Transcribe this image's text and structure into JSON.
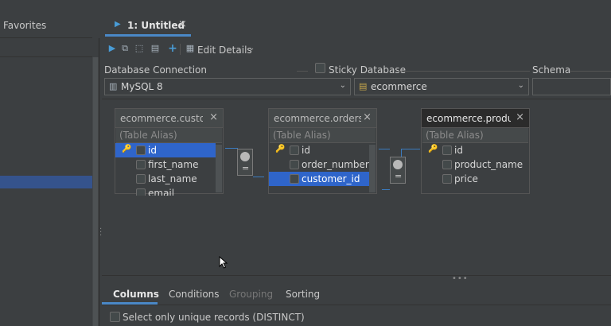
{
  "left_panel": {
    "title": "Favorites"
  },
  "tab": {
    "label": "1: Untitled",
    "close": "×"
  },
  "toolbar": {
    "edit_details": "Edit Details"
  },
  "connection": {
    "db_connection_label": "Database Connection",
    "sticky_label": "Sticky Database",
    "schema_label": "Schema",
    "db_value": "MySQL 8",
    "schema_value": "ecommerce"
  },
  "tables": [
    {
      "name": "ecommerce.custo...",
      "alias_placeholder": "(Table Alias)",
      "columns": [
        {
          "name": "id",
          "key": true,
          "selected": true
        },
        {
          "name": "first_name",
          "key": false,
          "selected": false
        },
        {
          "name": "last_name",
          "key": false,
          "selected": false
        },
        {
          "name": "email",
          "key": false,
          "selected": false
        }
      ]
    },
    {
      "name": "ecommerce.orders",
      "alias_placeholder": "(Table Alias)",
      "columns": [
        {
          "name": "id",
          "key": true,
          "selected": false
        },
        {
          "name": "order_number",
          "key": false,
          "selected": false
        },
        {
          "name": "customer_id",
          "key": false,
          "selected": true
        }
      ]
    },
    {
      "name": "ecommerce.produ...",
      "alias_placeholder": "(Table Alias)",
      "columns": [
        {
          "name": "id",
          "key": true,
          "selected": false
        },
        {
          "name": "product_name",
          "key": false,
          "selected": false
        },
        {
          "name": "price",
          "key": false,
          "selected": false
        }
      ]
    }
  ],
  "join_symbol": "=",
  "bottom_tabs": [
    "Columns",
    "Conditions",
    "Grouping",
    "Sorting"
  ],
  "distinct_label": "Select only unique records (DISTINCT)",
  "colors": {
    "accent": "#4a88c7",
    "selection": "#2f65ca",
    "key": "#d6b25c"
  }
}
